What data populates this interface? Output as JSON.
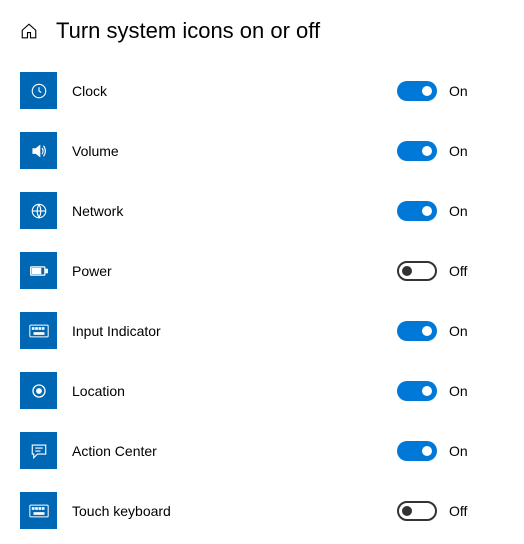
{
  "header": {
    "title": "Turn system icons on or off"
  },
  "labels": {
    "on": "On",
    "off": "Off"
  },
  "items": [
    {
      "label": "Clock",
      "icon": "clock-icon",
      "state": "on"
    },
    {
      "label": "Volume",
      "icon": "volume-icon",
      "state": "on"
    },
    {
      "label": "Network",
      "icon": "network-icon",
      "state": "on"
    },
    {
      "label": "Power",
      "icon": "power-icon",
      "state": "off"
    },
    {
      "label": "Input Indicator",
      "icon": "keyboard-icon",
      "state": "on"
    },
    {
      "label": "Location",
      "icon": "location-icon",
      "state": "on"
    },
    {
      "label": "Action Center",
      "icon": "action-center-icon",
      "state": "on"
    },
    {
      "label": "Touch keyboard",
      "icon": "touch-keyboard-icon",
      "state": "off"
    }
  ],
  "colors": {
    "accent": "#0078d7",
    "iconBox": "#0067b5"
  }
}
